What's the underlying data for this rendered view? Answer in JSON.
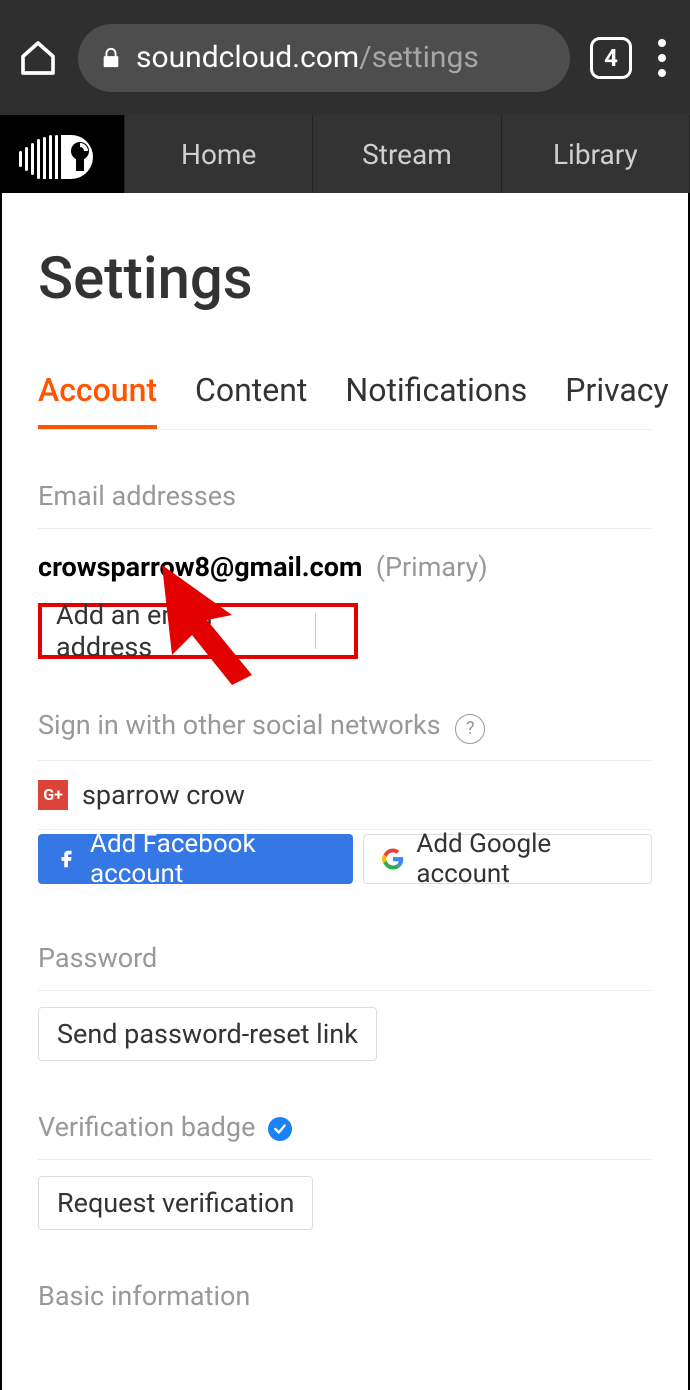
{
  "browser": {
    "tab_count": "4",
    "url_host": "soundcloud.com",
    "url_path": "/settings"
  },
  "nav": {
    "home": "Home",
    "stream": "Stream",
    "library": "Library"
  },
  "page": {
    "title": "Settings"
  },
  "tabs": {
    "account": "Account",
    "content": "Content",
    "notifications": "Notifications",
    "privacy": "Privacy"
  },
  "email": {
    "section_label": "Email addresses",
    "address": "crowsparrow8@gmail.com",
    "primary_label": "(Primary)",
    "add_placeholder": "Add an email address"
  },
  "social": {
    "section_label": "Sign in with other social networks",
    "connected_name": "sparrow crow",
    "add_facebook": "Add Facebook account",
    "add_google": "Add Google account"
  },
  "password": {
    "section_label": "Password",
    "reset_button": "Send password-reset link"
  },
  "verification": {
    "section_label": "Verification badge",
    "request_button": "Request verification"
  },
  "basic_info": {
    "section_label": "Basic information"
  }
}
